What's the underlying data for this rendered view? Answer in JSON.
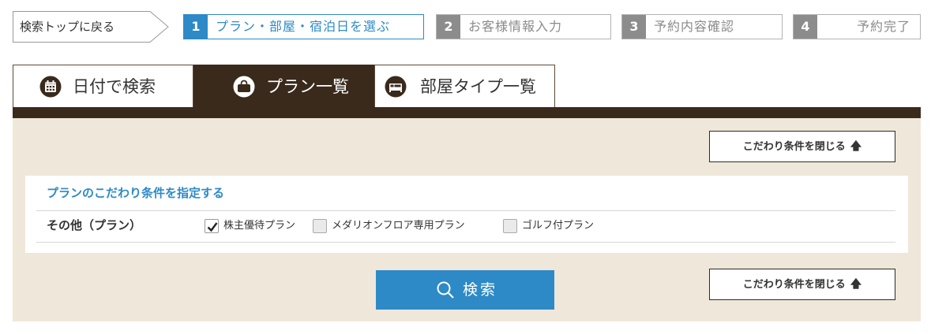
{
  "stepbar": {
    "back_label": "検索トップに戻る",
    "steps": [
      {
        "num": "1",
        "label": "プラン・部屋・宿泊日を選ぶ",
        "active": true
      },
      {
        "num": "2",
        "label": "お客様情報入力",
        "active": false
      },
      {
        "num": "3",
        "label": "予約内容確認",
        "active": false
      },
      {
        "num": "4",
        "label": "予約完了",
        "active": false
      }
    ]
  },
  "tabs": [
    {
      "label": "日付で検索",
      "icon": "calendar-icon",
      "active": false
    },
    {
      "label": "プラン一覧",
      "icon": "bag-icon",
      "active": true
    },
    {
      "label": "部屋タイプ一覧",
      "icon": "bed-icon",
      "active": false
    }
  ],
  "filter": {
    "close_label": "こだわり条件を閉じる",
    "close_arrow": "up-arrow-icon",
    "title": "プランのこだわり条件を指定する",
    "row_label": "その他（プラン）",
    "options": [
      {
        "label": "株主優待プラン",
        "checked": true
      },
      {
        "label": "メダリオンフロア専用プラン",
        "checked": false
      },
      {
        "label": "ゴルフ付プラン",
        "checked": false
      }
    ],
    "search_label": "検索"
  },
  "colors": {
    "accent": "#2d8ac6",
    "dark_brown": "#3a2a1c",
    "panel_beige": "#efe7d9",
    "inactive_step": "#8c8c8c"
  }
}
